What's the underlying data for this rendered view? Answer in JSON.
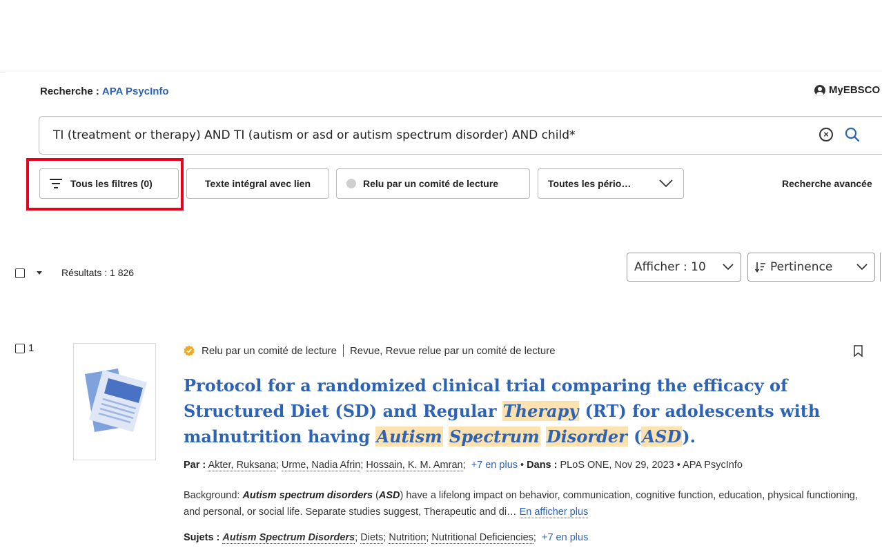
{
  "header": {
    "search_label": "Recherche :",
    "database": "APA PsycInfo",
    "account_label": "MyEBSCO"
  },
  "search": {
    "query": "TI (treatment or therapy) AND TI (autism or asd or autism spectrum disorder) AND child*"
  },
  "filters": {
    "all_filters": "Tous les filtres (0)",
    "full_text": "Texte intégral avec lien",
    "peer_reviewed": "Relu par un comité de lecture",
    "periods": "Toutes les pério…",
    "advanced_search": "Recherche avancée"
  },
  "results_bar": {
    "count_label": "Résultats : 1 826",
    "show_label": "Afficher : 10",
    "sort_label": "Pertinence"
  },
  "result": {
    "number": "1",
    "peer_label": "Relu par un comité de lecture",
    "type_label": "Revue, Revue relue par un comité de lecture",
    "title_parts": [
      "Protocol for a randomized clinical trial comparing the efficacy of Structured Diet (SD) and Regular ",
      "Therapy",
      " (RT) for adolescents with malnutrition having ",
      "Autism",
      " ",
      "Spectrum",
      " ",
      "Disorder",
      " (",
      "ASD",
      ")."
    ],
    "by_label": "Par :",
    "authors": [
      "Akter, Ruksana",
      "Urme, Nadia Afrin",
      "Hossain, K. M. Amran"
    ],
    "authors_more": "+7 en plus",
    "in_label": "Dans :",
    "source": "PLoS ONE, Nov 29, 2023",
    "database": "APA PsycInfo",
    "abstract_parts": [
      "Background: ",
      "Autism spectrum disorders",
      " (",
      "ASD",
      ") have a lifelong impact on behavior, communication, cognitive function, education, physical functioning, and personal, or social life. Separate studies suggest, Therapeutic and di… "
    ],
    "show_more": "En afficher plus",
    "subjects_label": "Sujets :",
    "subjects": [
      "Autism Spectrum Disorders",
      "Diets",
      "Nutrition",
      "Nutritional Deficiencies"
    ],
    "subjects_more": "+7 en plus"
  },
  "colors": {
    "link_blue": "#2d63b5",
    "highlight": "#fde2b0",
    "annotation_red": "#e8001c",
    "badge_gold": "#f2a81d"
  }
}
